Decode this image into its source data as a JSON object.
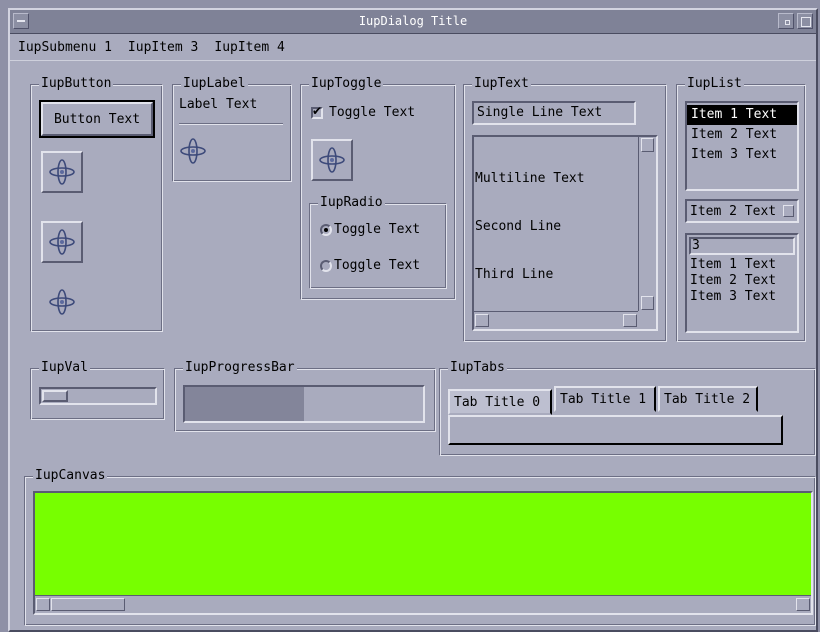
{
  "window": {
    "title": "IupDialog Title"
  },
  "menubar": {
    "items": [
      "IupSubmenu 1",
      "IupItem 3",
      "IupItem 4"
    ]
  },
  "frames": {
    "button": "IupButton",
    "label": "IupLabel",
    "toggle": "IupToggle",
    "radio": "IupRadio",
    "text": "IupText",
    "list": "IupList",
    "val": "IupVal",
    "progress": "IupProgressBar",
    "tabs": "IupTabs",
    "canvas": "IupCanvas"
  },
  "button": {
    "label": "Button Text"
  },
  "label": {
    "text": "Label Text"
  },
  "toggle": {
    "label": "Toggle Text",
    "checked": true
  },
  "radio": {
    "options": [
      "Toggle Text",
      "Toggle Text"
    ],
    "selected": 0
  },
  "text": {
    "single_line": "Single Line Text",
    "multiline": [
      "Multiline Text",
      "Second Line",
      "Third Line"
    ]
  },
  "list": {
    "items": [
      "Item 1 Text",
      "Item 2 Text",
      "Item 3 Text"
    ],
    "selected": 0,
    "dropdown_value": "Item 2 Text",
    "edit_value": "3",
    "edit_items": [
      "Item 1 Text",
      "Item 2 Text",
      "Item 3 Text"
    ]
  },
  "val": {
    "value": 0.0
  },
  "progress": {
    "value": 0.5
  },
  "tabs": {
    "titles": [
      "Tab Title 0",
      "Tab Title 1",
      "Tab Title 2"
    ],
    "active": 0
  },
  "canvas": {
    "color": "#77FF00"
  },
  "colors": {
    "background": "#A9ABBE",
    "desktop": "#8E90A6",
    "titlebar": "#7F8297",
    "progress_fill": "#83859A"
  }
}
